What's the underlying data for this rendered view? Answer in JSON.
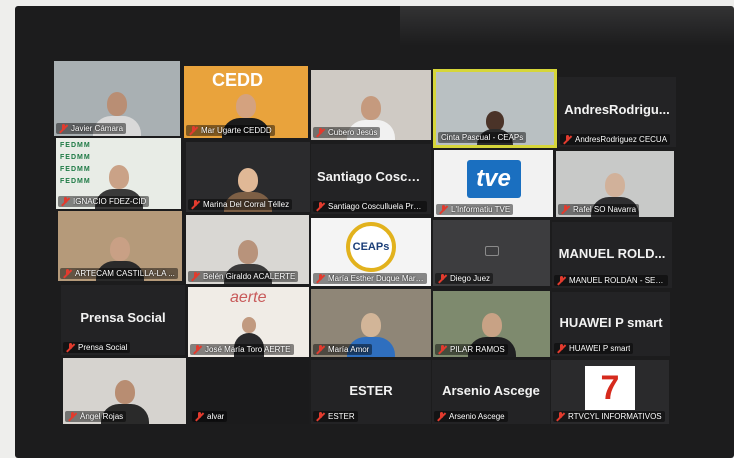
{
  "app": {
    "name": "Video conference gallery view"
  },
  "colors": {
    "active_speaker_border": "#d6d63a",
    "muted_mic": "#e23b2e",
    "tile_bg": "#232325"
  },
  "participants": [
    {
      "name": "Javier Cámara",
      "muted": true,
      "video": true
    },
    {
      "name": "Mar Ugarte CEDDD",
      "muted": true,
      "video": true
    },
    {
      "name": "Cubero Jesús",
      "muted": true,
      "video": true
    },
    {
      "name": "Cinta Pascual - CEAPs",
      "muted": false,
      "video": true,
      "active_speaker": true
    },
    {
      "name": "AndresRodriguez CECUA",
      "display": "AndresRodrigu...",
      "muted": true,
      "video": false
    },
    {
      "name": "IGNACIO FDEZ-CID",
      "muted": true,
      "video": true
    },
    {
      "name": "Marina Del Corral Téllez",
      "muted": true,
      "video": true
    },
    {
      "name": "Santiago Cosculluela Pre...",
      "display": "Santiago Cosculluela",
      "muted": true,
      "video": false
    },
    {
      "name": "L'Informatiu TVE",
      "muted": true,
      "video": true,
      "logo": "tve"
    },
    {
      "name": "Rafel SO Navarra",
      "muted": true,
      "video": true
    },
    {
      "name": "ARTECAM CASTILLA-LA ...",
      "muted": true,
      "video": true
    },
    {
      "name": "Belén Giraldo ACALERTE",
      "muted": true,
      "video": true
    },
    {
      "name": "María Esther Duque Mart...",
      "muted": true,
      "video": true,
      "logo": "CEAPs"
    },
    {
      "name": "Diego Juez",
      "muted": true,
      "video": false
    },
    {
      "name": "MANUEL ROLDÁN - SECR...",
      "display": "MANUEL ROLD...",
      "muted": true,
      "video": false
    },
    {
      "name": "Prensa Social",
      "display": "Prensa Social",
      "muted": true,
      "video": false
    },
    {
      "name": "José María Toro AERTE",
      "muted": true,
      "video": true,
      "banner": "aerte"
    },
    {
      "name": "María Amor",
      "muted": true,
      "video": true
    },
    {
      "name": "PILAR RAMOS",
      "muted": true,
      "video": true
    },
    {
      "name": "HUAWEI P smart",
      "display": "HUAWEI P smart",
      "muted": true,
      "video": false
    },
    {
      "name": "Ángel Rojas",
      "muted": true,
      "video": true
    },
    {
      "name": "alvar",
      "muted": true,
      "video": false
    },
    {
      "name": "ESTER",
      "display": "ESTER",
      "muted": true,
      "video": false
    },
    {
      "name": "Arsenio Ascege",
      "display": "Arsenio Ascege",
      "muted": true,
      "video": false
    },
    {
      "name": "RTVCYL INFORMATIVOS",
      "muted": true,
      "video": true,
      "logo": "7"
    }
  ],
  "decor": {
    "cedd_logo": "CEDD",
    "backdrop_word": "FEDMM",
    "tve_logo": "tve",
    "ceaps_logo": "CEAPs",
    "aerte_banner": "aerte",
    "rtvcyl_logo": "7"
  }
}
